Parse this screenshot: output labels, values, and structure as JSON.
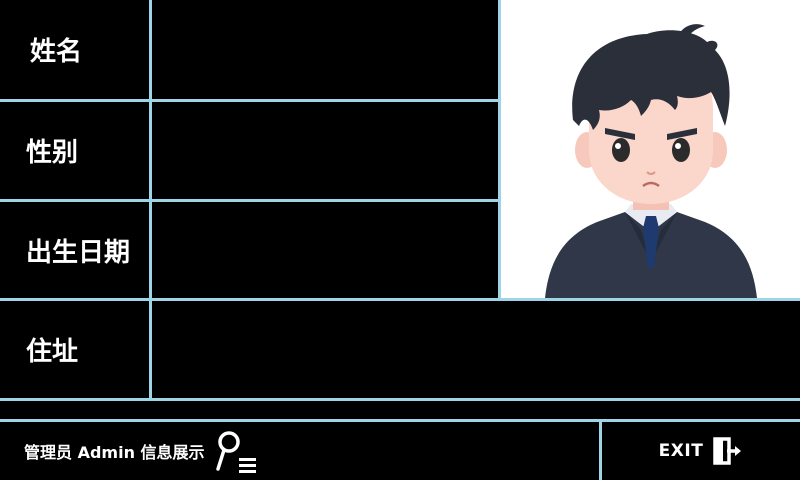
{
  "fields": [
    {
      "label": "姓名",
      "value": ""
    },
    {
      "label": "性别",
      "value": ""
    },
    {
      "label": "出生日期",
      "value": ""
    },
    {
      "label": "住址",
      "value": ""
    }
  ],
  "footer": {
    "admin_text": "管理员 Admin 信息展示",
    "admin_icon": "user-list-icon",
    "exit_label": "EXIT",
    "exit_icon": "exit-door-icon"
  },
  "photo": {
    "icon": "avatar-photo"
  },
  "colors": {
    "background": "#000000",
    "grid_line": "#9fd3e6",
    "text": "#ffffff",
    "photo_bg": "#ffffff"
  }
}
